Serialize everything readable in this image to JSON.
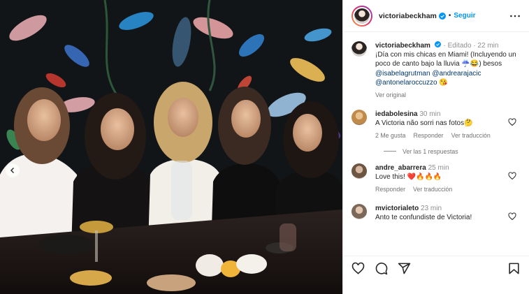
{
  "header": {
    "username": "victoriabeckham",
    "separator": "•",
    "follow_label": "Seguir",
    "more_icon": "more-horizontal-icon"
  },
  "caption": {
    "username": "victoriabeckham",
    "edited": "· Editado ·",
    "time": "22 min",
    "text": "¡Día con mis chicas en Miami! (Incluyendo un poco de canto bajo la lluvia ☔😂) besos",
    "mention1": "@isabelagrutman",
    "mention2": "@andrearajacic",
    "mention3": "@antonelaroccuzzo",
    "emoji": "😘",
    "see_original": "Ver original"
  },
  "comments": [
    {
      "username": "iedabolesina",
      "time": "30 min",
      "text": "A Victoria não sorri nas fotos🤔",
      "likes": "2 Me gusta",
      "reply": "Responder",
      "translate": "Ver traducción",
      "replies": "Ver las 1 respuestas"
    },
    {
      "username": "andre_abarrera",
      "time": "25 min",
      "text": "Love this! ❤️🔥🔥🔥",
      "reply": "Responder",
      "translate": "Ver traducción"
    },
    {
      "username": "mvictorialeto",
      "time": "23 min",
      "text": "Anto te confundiste de Victoria!"
    }
  ],
  "actions": {
    "like_icon": "heart-icon",
    "comment_icon": "comment-icon",
    "share_icon": "share-icon",
    "save_icon": "bookmark-icon"
  },
  "colors": {
    "accent": "#0095f6",
    "verified": "#0095f6",
    "link": "#00376b",
    "muted": "#737373"
  }
}
